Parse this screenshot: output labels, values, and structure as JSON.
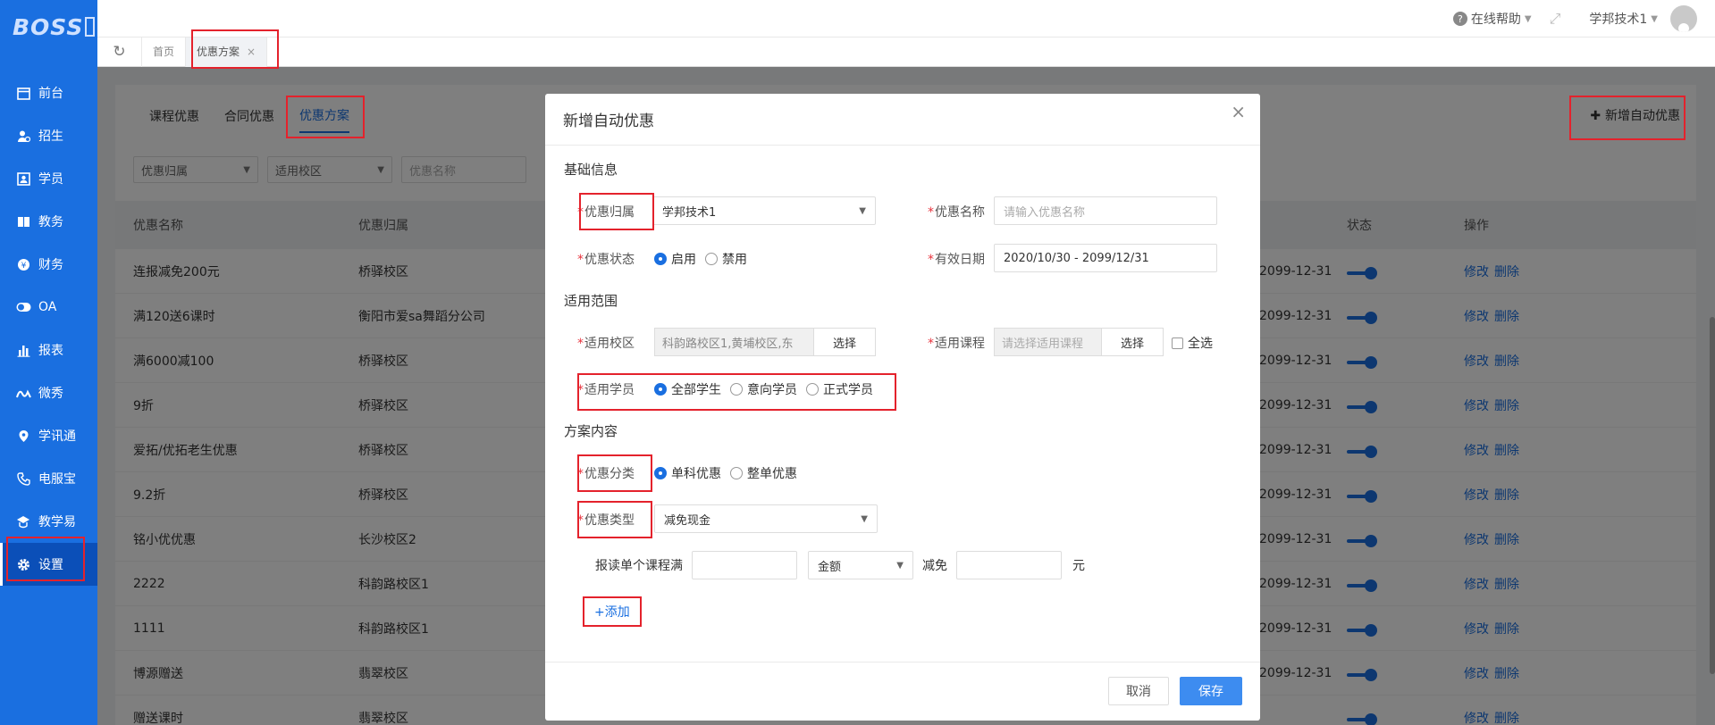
{
  "logo": "BOSS",
  "sidebar": {
    "items": [
      {
        "label": "前台",
        "icon": "calendar-icon"
      },
      {
        "label": "招生",
        "icon": "user-plus-icon"
      },
      {
        "label": "学员",
        "icon": "id-card-icon"
      },
      {
        "label": "教务",
        "icon": "book-icon"
      },
      {
        "label": "财务",
        "icon": "yen-icon"
      },
      {
        "label": "OA",
        "icon": "toggle-icon"
      },
      {
        "label": "报表",
        "icon": "bar-chart-icon"
      },
      {
        "label": "微秀",
        "icon": "wave-icon"
      },
      {
        "label": "学讯通",
        "icon": "location-icon"
      },
      {
        "label": "电服宝",
        "icon": "phone-icon"
      },
      {
        "label": "教学易",
        "icon": "teach-icon"
      },
      {
        "label": "设置",
        "icon": "gear-icon"
      }
    ],
    "active_index": 11
  },
  "topbar": {
    "help": "在线帮助",
    "user": "学邦技术1"
  },
  "tabs": {
    "home": "首页",
    "current": "优惠方案",
    "close": "×"
  },
  "page": {
    "subtabs": [
      "课程优惠",
      "合同优惠",
      "优惠方案"
    ],
    "active_subtab": 2,
    "add_button": "新增自动优惠",
    "filters": {
      "owner": "优惠归属",
      "campus": "适用校区",
      "name_placeholder": "优惠名称"
    },
    "table": {
      "headers": {
        "name": "优惠名称",
        "owner": "优惠归属",
        "status": "状态",
        "ops": "操作"
      },
      "edit": "修改",
      "delete": "删除",
      "rows": [
        {
          "name": "连报减免200元",
          "owner": "桥驿校区",
          "end": "2099-12-31"
        },
        {
          "name": "满120送6课时",
          "owner": "衡阳市爱sa舞蹈分公司",
          "end": "2099-12-31"
        },
        {
          "name": "满6000减100",
          "owner": "桥驿校区",
          "end": "2099-12-31"
        },
        {
          "name": "9折",
          "owner": "桥驿校区",
          "end": "2099-12-31"
        },
        {
          "name": "爱拓/优拓老生优惠",
          "owner": "桥驿校区",
          "end": "2099-12-31"
        },
        {
          "name": "9.2折",
          "owner": "桥驿校区",
          "end": "2099-12-31"
        },
        {
          "name": "铭小优优惠",
          "owner": "长沙校区2",
          "end": "2099-12-31"
        },
        {
          "name": "2222",
          "owner": "科韵路校区1",
          "end": "2099-12-31"
        },
        {
          "name": "1111",
          "owner": "科韵路校区1",
          "end": "2099-12-31"
        },
        {
          "name": "博源赠送",
          "owner": "翡翠校区",
          "end": "2099-12-31"
        },
        {
          "name": "赠送课时",
          "owner": "翡翠校区",
          "end": ""
        }
      ]
    }
  },
  "modal": {
    "title": "新增自动优惠",
    "close": "×",
    "sections": {
      "basic": "基础信息",
      "scope": "适用范围",
      "content": "方案内容"
    },
    "fields": {
      "owner_label": "优惠归属",
      "owner_value": "学邦技术1",
      "name_label": "优惠名称",
      "name_placeholder": "请输入优惠名称",
      "status_label": "优惠状态",
      "status_options": [
        "启用",
        "禁用"
      ],
      "date_label": "有效日期",
      "date_value": "2020/10/30 - 2099/12/31",
      "campus_label": "适用校区",
      "campus_value": "科韵路校区1,黄埔校区,东",
      "campus_pick": "选择",
      "course_label": "适用课程",
      "course_placeholder": "请选择适用课程",
      "course_pick": "选择",
      "select_all": "全选",
      "student_label": "适用学员",
      "student_options": [
        "全部学生",
        "意向学员",
        "正式学员"
      ],
      "category_label": "优惠分类",
      "category_options": [
        "单科优惠",
        "整单优惠"
      ],
      "type_label": "优惠类型",
      "type_value": "减免现金",
      "rule_prefix": "报读单个课程满",
      "rule_unit": "金额",
      "rule_minus": "减免",
      "rule_suffix": "元",
      "add_link": "+添加"
    },
    "footer": {
      "cancel": "取消",
      "save": "保存"
    }
  },
  "colors": {
    "primary": "#1a6fe0",
    "sidebar_active": "#0b4fb8",
    "highlight": "#e4222c",
    "required": "#e8343e",
    "save_button": "#3d8cf0"
  }
}
